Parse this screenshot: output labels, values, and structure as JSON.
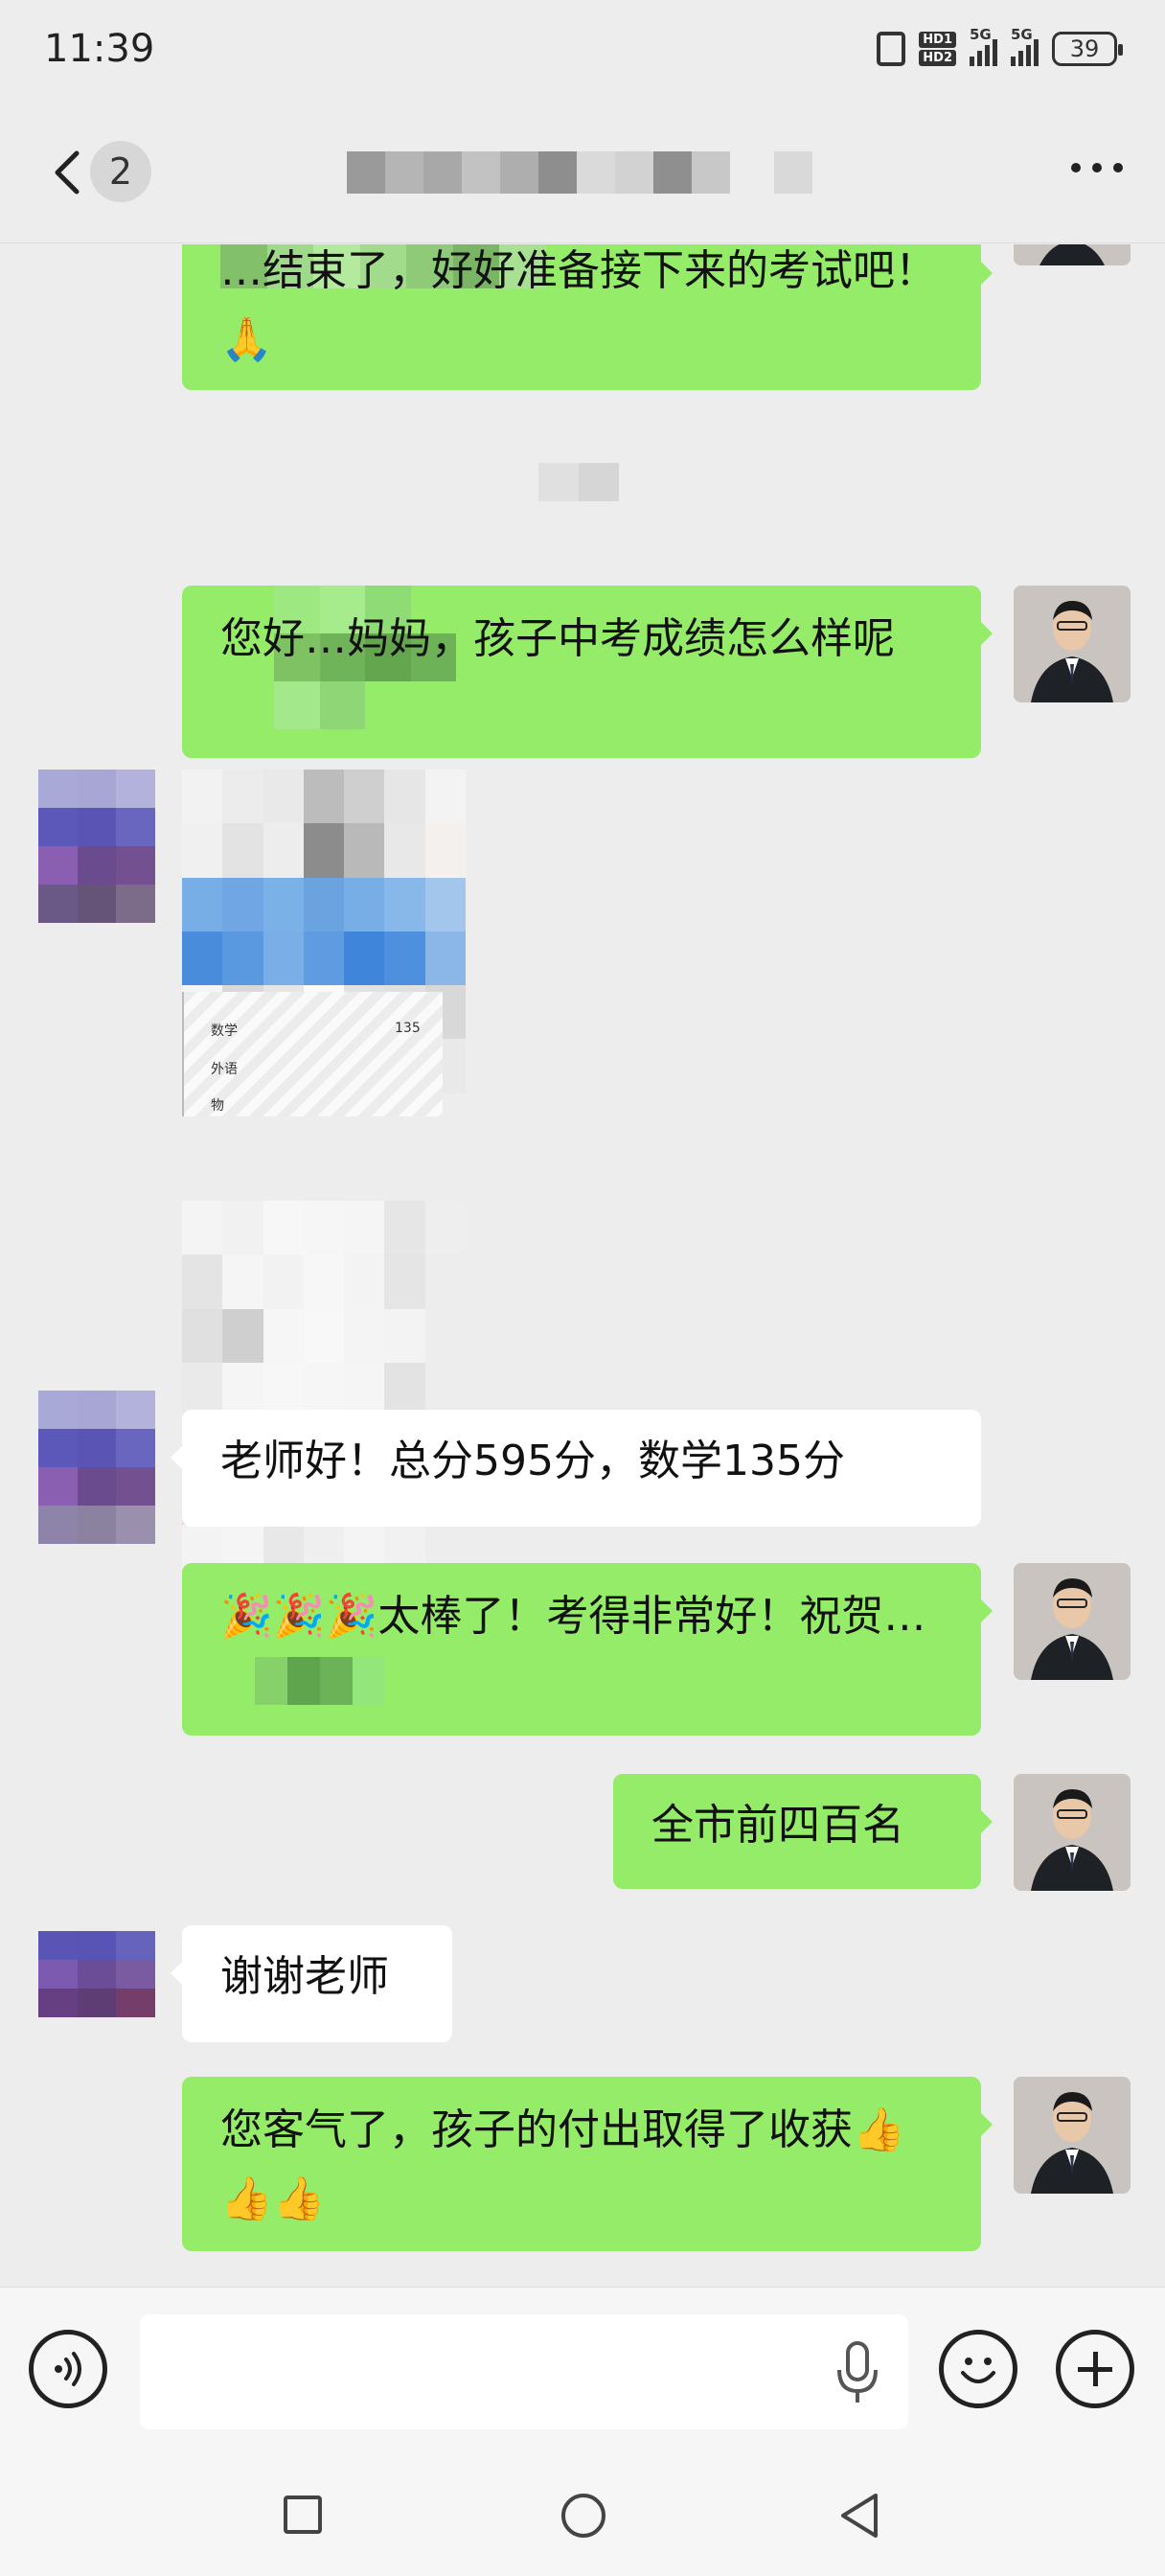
{
  "status_bar": {
    "time": "11:39",
    "hd1": "HD1",
    "hd2": "HD2",
    "net1": "5G",
    "net2": "5G",
    "battery": "39"
  },
  "header": {
    "unread_count": "2"
  },
  "messages": [
    {
      "side": "out",
      "text": "…结束了，好好准备接下来的考试吧！🙏"
    },
    {
      "side": "out",
      "text": "您好…妈妈，孩子中考成绩怎么样呢"
    },
    {
      "side": "in",
      "type": "image"
    },
    {
      "side": "in",
      "text": "老师好！总分595分，数学135分"
    },
    {
      "side": "out",
      "text": "🎉🎉🎉太棒了！考得非常好！祝贺…"
    },
    {
      "side": "out",
      "text": "全市前四百名"
    },
    {
      "side": "in",
      "text": "谢谢老师"
    },
    {
      "side": "out",
      "text": "您客气了，孩子的付出取得了收获👍👍👍"
    }
  ],
  "image_labels": {
    "row1_subject": "数学",
    "row1_score": "135",
    "row2_subject": "外语",
    "row3_subject": "物"
  },
  "input": {
    "placeholder": ""
  },
  "colors": {
    "out_bubble": "#95ec69",
    "in_bubble": "#ffffff",
    "background": "#ededed"
  },
  "icons": [
    "back-chevron-icon",
    "more-icon",
    "voice-icon",
    "mic-icon",
    "emoji-icon",
    "plus-icon",
    "nav-recent-icon",
    "nav-home-icon",
    "nav-back-icon"
  ]
}
